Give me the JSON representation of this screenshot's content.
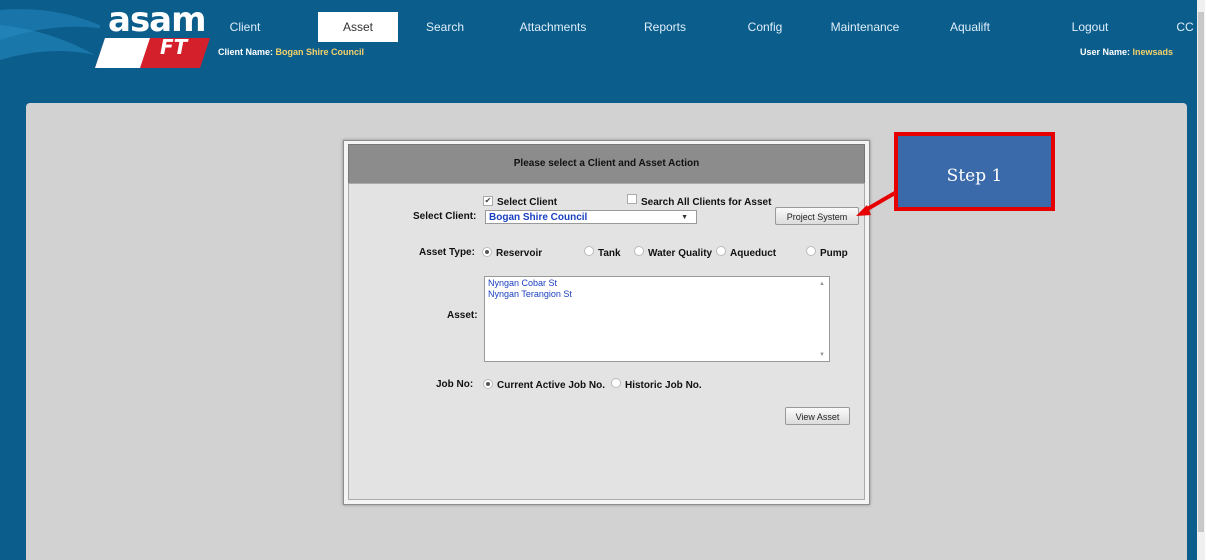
{
  "logo": {
    "text": "asam",
    "sub": "FT"
  },
  "nav": {
    "items": [
      "Client",
      "Asset",
      "Search",
      "Attachments",
      "Reports",
      "Config",
      "Maintenance",
      "Aqualift",
      "Logout",
      "CC"
    ],
    "active": "Asset"
  },
  "header": {
    "client_label": "Client Name:",
    "client_value": "Bogan Shire Council",
    "user_label": "User Name:",
    "user_value": "lnewsads"
  },
  "panel": {
    "title": "Please select a Client and Asset Action",
    "select_client_check": "Select Client",
    "search_all_check": "Search All Clients for Asset",
    "select_client_label": "Select Client:",
    "client_value": "Bogan Shire Council",
    "project_system": "Project System",
    "asset_type_label": "Asset Type:",
    "asset_types": [
      "Reservoir",
      "Tank",
      "Water Quality",
      "Aqueduct",
      "Pump"
    ],
    "asset_type_selected": "Reservoir",
    "asset_label": "Asset:",
    "assets": [
      "Nyngan Cobar St",
      "Nyngan Terangion St"
    ],
    "job_no_label": "Job No:",
    "job_options": [
      "Current Active Job No.",
      "Historic Job No."
    ],
    "view_asset": "View Asset"
  },
  "callout": {
    "label": "Step 1",
    "border_color": "#e60000",
    "fill_color": "#3b6aaa"
  },
  "colors": {
    "header": "#0b5e8c",
    "content": "#d2d2d2"
  }
}
